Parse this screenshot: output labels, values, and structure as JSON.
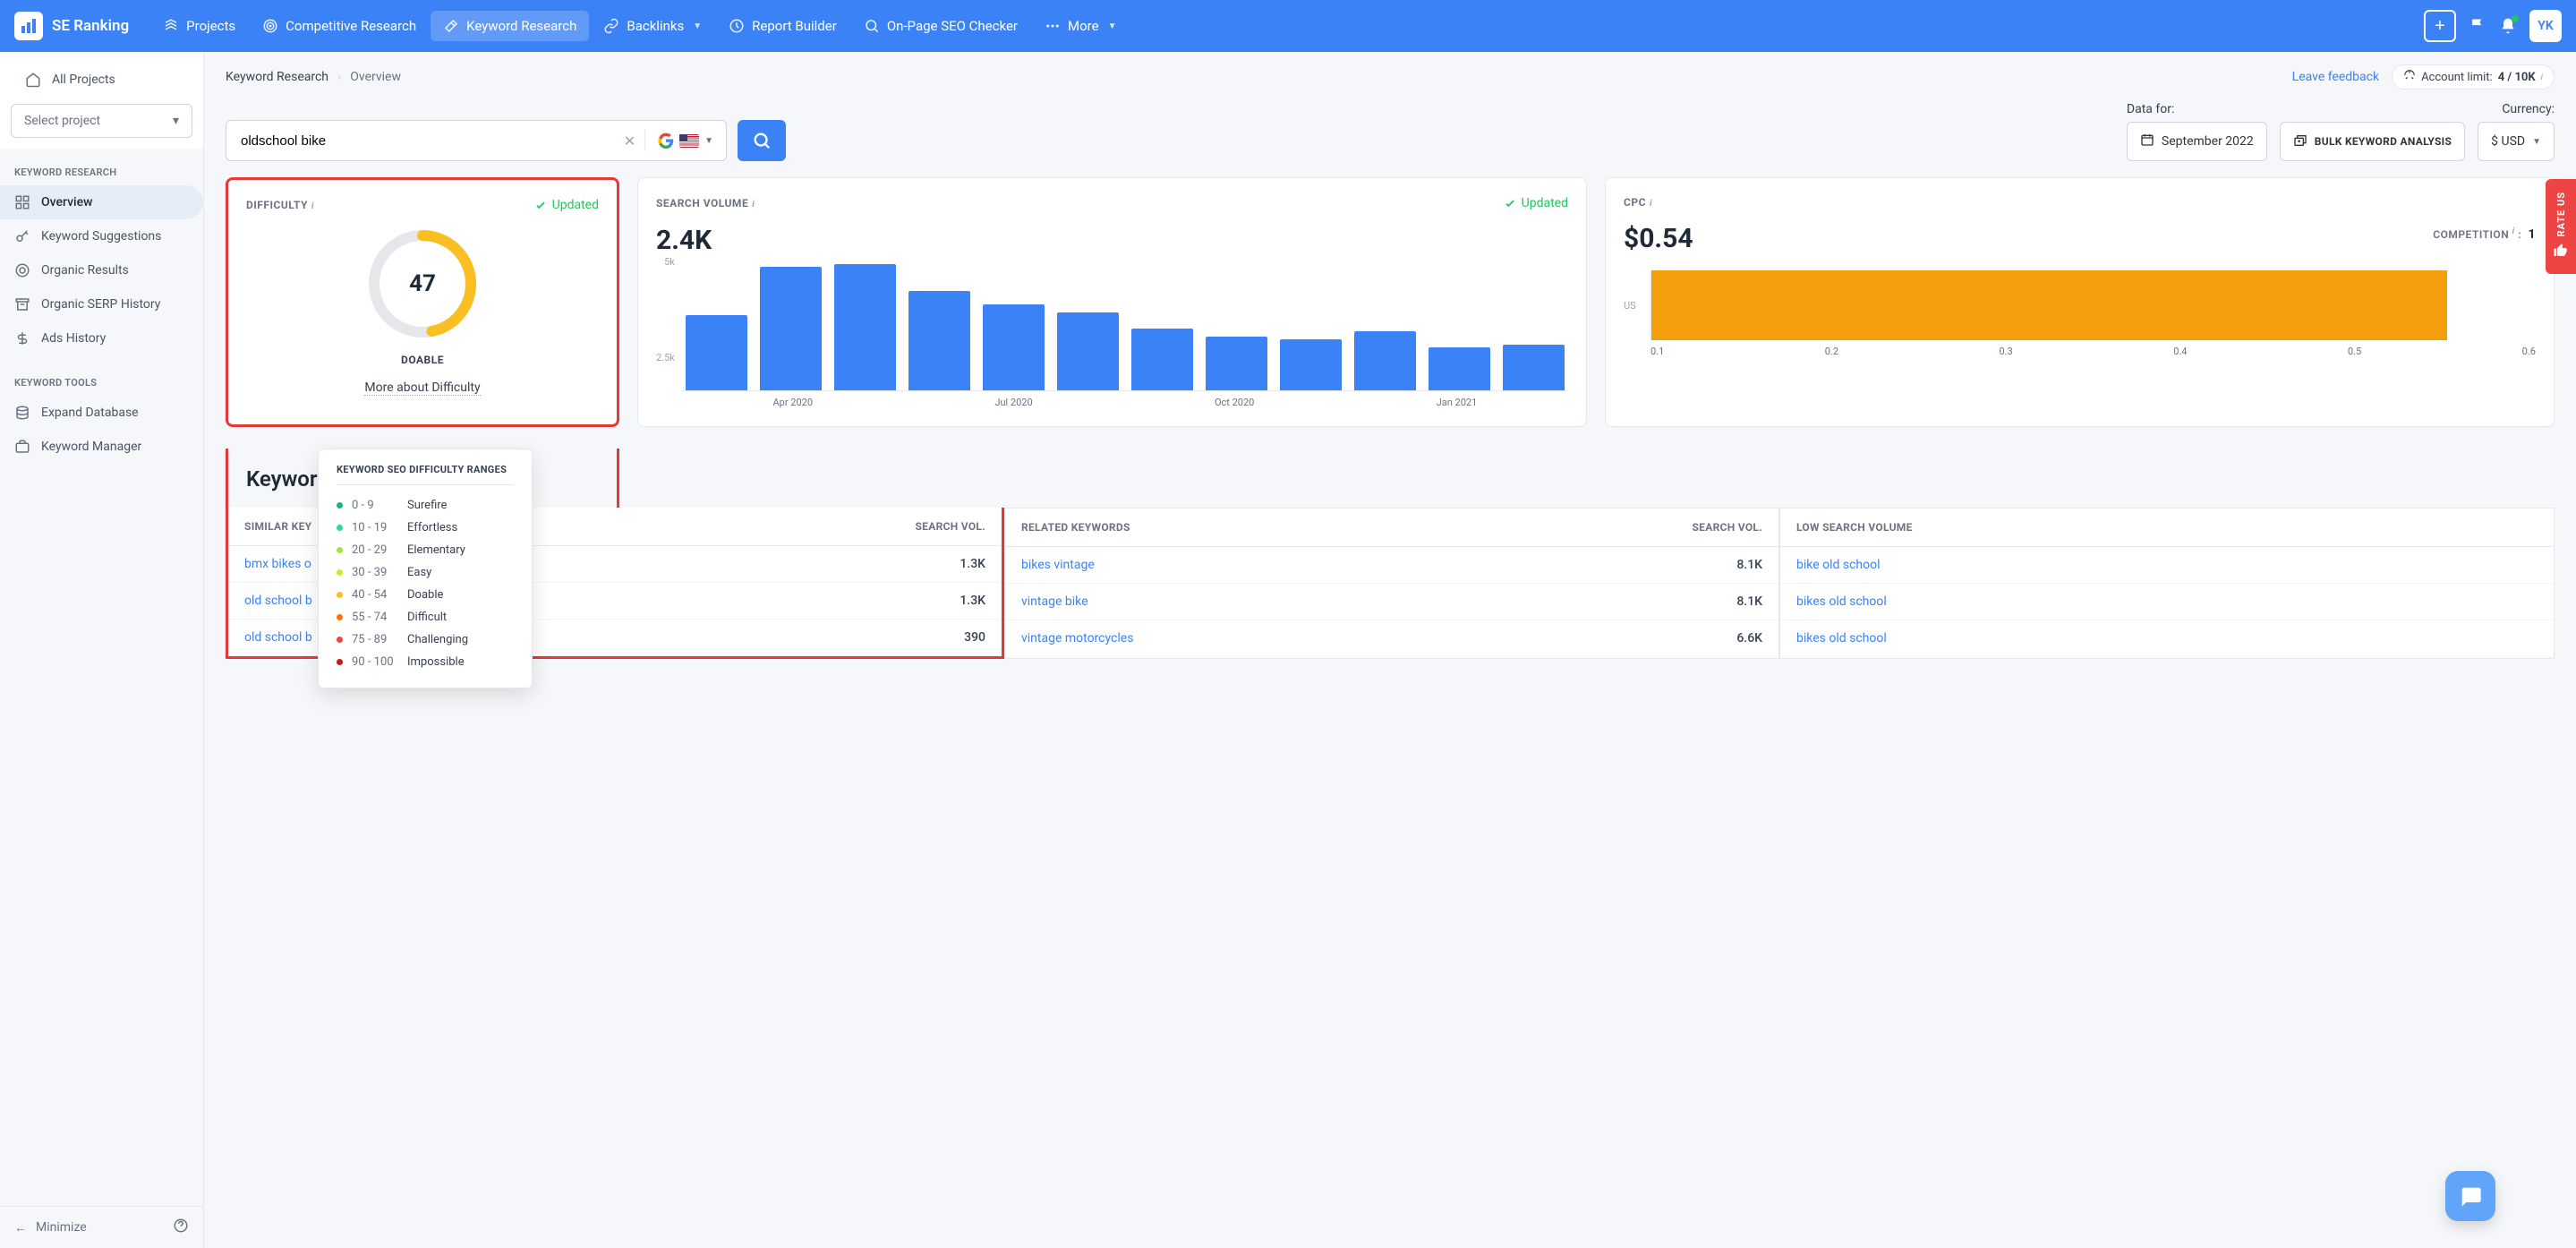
{
  "app": {
    "name": "SE Ranking",
    "avatar": "YK"
  },
  "nav": {
    "items": [
      {
        "label": "Projects",
        "icon": "projects-icon",
        "active": false
      },
      {
        "label": "Competitive Research",
        "icon": "target-icon",
        "active": false
      },
      {
        "label": "Keyword Research",
        "icon": "wand-icon",
        "active": true
      },
      {
        "label": "Backlinks",
        "icon": "link-icon",
        "chevron": true,
        "active": false
      },
      {
        "label": "Report Builder",
        "icon": "clock-icon",
        "active": false
      },
      {
        "label": "On-Page SEO Checker",
        "icon": "search-icon",
        "active": false
      }
    ],
    "more": "More"
  },
  "sidebar": {
    "all_projects": "All Projects",
    "select_project": "Select project",
    "section1_title": "KEYWORD RESEARCH",
    "section1_items": [
      {
        "label": "Overview",
        "active": true
      },
      {
        "label": "Keyword Suggestions"
      },
      {
        "label": "Organic Results"
      },
      {
        "label": "Organic SERP History"
      },
      {
        "label": "Ads History"
      }
    ],
    "section2_title": "KEYWORD TOOLS",
    "section2_items": [
      {
        "label": "Expand Database"
      },
      {
        "label": "Keyword Manager"
      }
    ],
    "minimize": "Minimize"
  },
  "breadcrumb": {
    "first": "Keyword Research",
    "second": "Overview"
  },
  "feedback": "Leave feedback",
  "account_limit": {
    "label": "Account limit:",
    "value": "4 / 10K"
  },
  "search": {
    "value": "oldschool bike",
    "locale": "US"
  },
  "data_for": {
    "label": "Data for:",
    "date": "September 2022"
  },
  "bulk": "BULK KEYWORD ANALYSIS",
  "currency": {
    "label": "Currency:",
    "value": "$ USD"
  },
  "difficulty": {
    "title": "DIFFICULTY",
    "updated": "Updated",
    "value": "47",
    "label": "DOABLE",
    "link": "More about Difficulty",
    "gauge_percent": 47
  },
  "volume": {
    "title": "SEARCH VOLUME",
    "updated": "Updated",
    "value": "2.4K"
  },
  "cpc": {
    "title": "CPC",
    "value": "$0.54",
    "competition_label": "COMPETITION",
    "competition_value": "1",
    "sep": ":"
  },
  "chart_data": [
    {
      "type": "bar",
      "title": "Search Volume",
      "ylabel": "",
      "ylim": [
        0,
        5000
      ],
      "yticks": [
        "5k",
        "2.5k"
      ],
      "categories": [
        "Apr 2020",
        "Jul 2020",
        "Oct 2020",
        "Jan 2021"
      ],
      "values": [
        2800,
        4600,
        4700,
        3700,
        3200,
        2900,
        2300,
        2000,
        1900,
        2200,
        1600,
        1700
      ]
    },
    {
      "type": "bar",
      "title": "CPC Competition",
      "orientation": "horizontal",
      "categories": [
        "US"
      ],
      "values": [
        0.54
      ],
      "xlim": [
        0,
        0.6
      ],
      "xticks": [
        "0.1",
        "0.2",
        "0.3",
        "0.4",
        "0.5",
        "0.6"
      ]
    }
  ],
  "ideas": {
    "title": "Keywor",
    "cols": [
      {
        "header1": "SIMILAR KEY",
        "header2": "SEARCH VOL.",
        "rows": [
          {
            "kw": "bmx bikes o",
            "vol": "1.3K"
          },
          {
            "kw": "old school b",
            "vol": "1.3K"
          },
          {
            "kw": "old school b",
            "vol": "390"
          }
        ]
      },
      {
        "header1": "RELATED KEYWORDS",
        "header2": "SEARCH VOL.",
        "rows": [
          {
            "kw": "bikes vintage",
            "vol": "8.1K"
          },
          {
            "kw": "vintage bike",
            "vol": "8.1K"
          },
          {
            "kw": "vintage motorcycles",
            "vol": "6.6K"
          }
        ]
      },
      {
        "header1": "LOW SEARCH VOLUME",
        "rows": [
          {
            "kw": "bike old school"
          },
          {
            "kw": "bikes old school"
          },
          {
            "kw": "bikes old school"
          }
        ]
      }
    ]
  },
  "tooltip": {
    "title": "KEYWORD SEO DIFFICULTY RANGES",
    "rows": [
      {
        "range": "0 - 9",
        "label": "Surefire",
        "color": "#10b981"
      },
      {
        "range": "10 - 19",
        "label": "Effortless",
        "color": "#34d399"
      },
      {
        "range": "20 - 29",
        "label": "Elementary",
        "color": "#a3e635"
      },
      {
        "range": "30 - 39",
        "label": "Easy",
        "color": "#d4e635"
      },
      {
        "range": "40 - 54",
        "label": "Doable",
        "color": "#fbbf24"
      },
      {
        "range": "55 - 74",
        "label": "Difficult",
        "color": "#f97316"
      },
      {
        "range": "75 - 89",
        "label": "Challenging",
        "color": "#ef4444"
      },
      {
        "range": "90 - 100",
        "label": "Impossible",
        "color": "#b91c1c"
      }
    ]
  },
  "rate_us": "RATE US"
}
